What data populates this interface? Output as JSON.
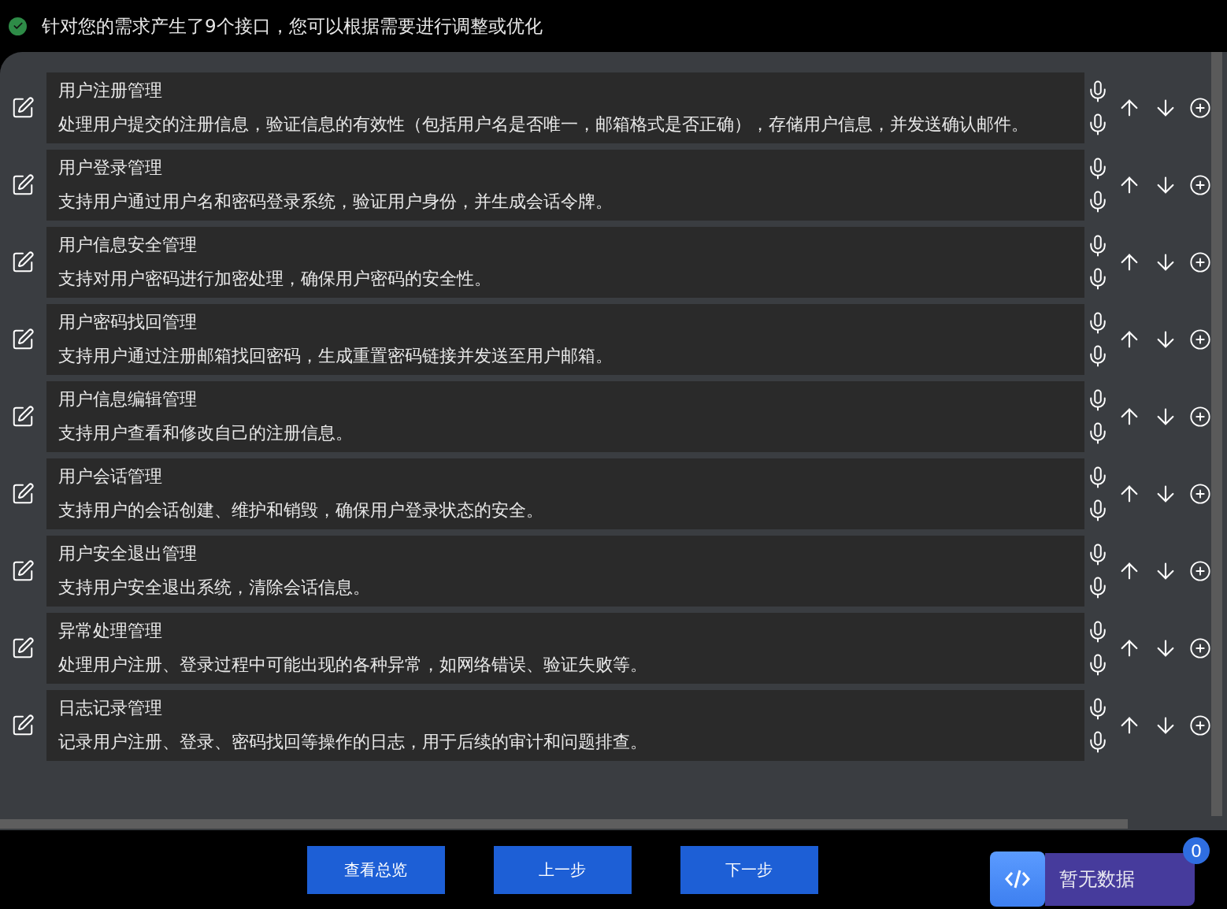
{
  "header": {
    "success": true,
    "message": "针对您的需求产生了9个接口，您可以根据需要进行调整或优化"
  },
  "interfaces": [
    {
      "title": "用户注册管理",
      "description": "处理用户提交的注册信息，验证信息的有效性（包括用户名是否唯一，邮箱格式是否正确），存储用户信息，并发送确认邮件。"
    },
    {
      "title": "用户登录管理",
      "description": "支持用户通过用户名和密码登录系统，验证用户身份，并生成会话令牌。"
    },
    {
      "title": "用户信息安全管理",
      "description": "支持对用户密码进行加密处理，确保用户密码的安全性。"
    },
    {
      "title": "用户密码找回管理",
      "description": "支持用户通过注册邮箱找回密码，生成重置密码链接并发送至用户邮箱。"
    },
    {
      "title": "用户信息编辑管理",
      "description": "支持用户查看和修改自己的注册信息。"
    },
    {
      "title": "用户会话管理",
      "description": "支持用户的会话创建、维护和销毁，确保用户登录状态的安全。"
    },
    {
      "title": "用户安全退出管理",
      "description": "支持用户安全退出系统，清除会话信息。"
    },
    {
      "title": "异常处理管理",
      "description": "处理用户注册、登录过程中可能出现的各种异常，如网络错误、验证失败等。"
    },
    {
      "title": "日志记录管理",
      "description": "记录用户注册、登录、密码找回等操作的日志，用于后续的审计和问题排查。"
    }
  ],
  "buttons": [
    "查看总览",
    "上一步",
    "下一步"
  ],
  "widget": {
    "label": "暂无数据",
    "badge": "0"
  }
}
